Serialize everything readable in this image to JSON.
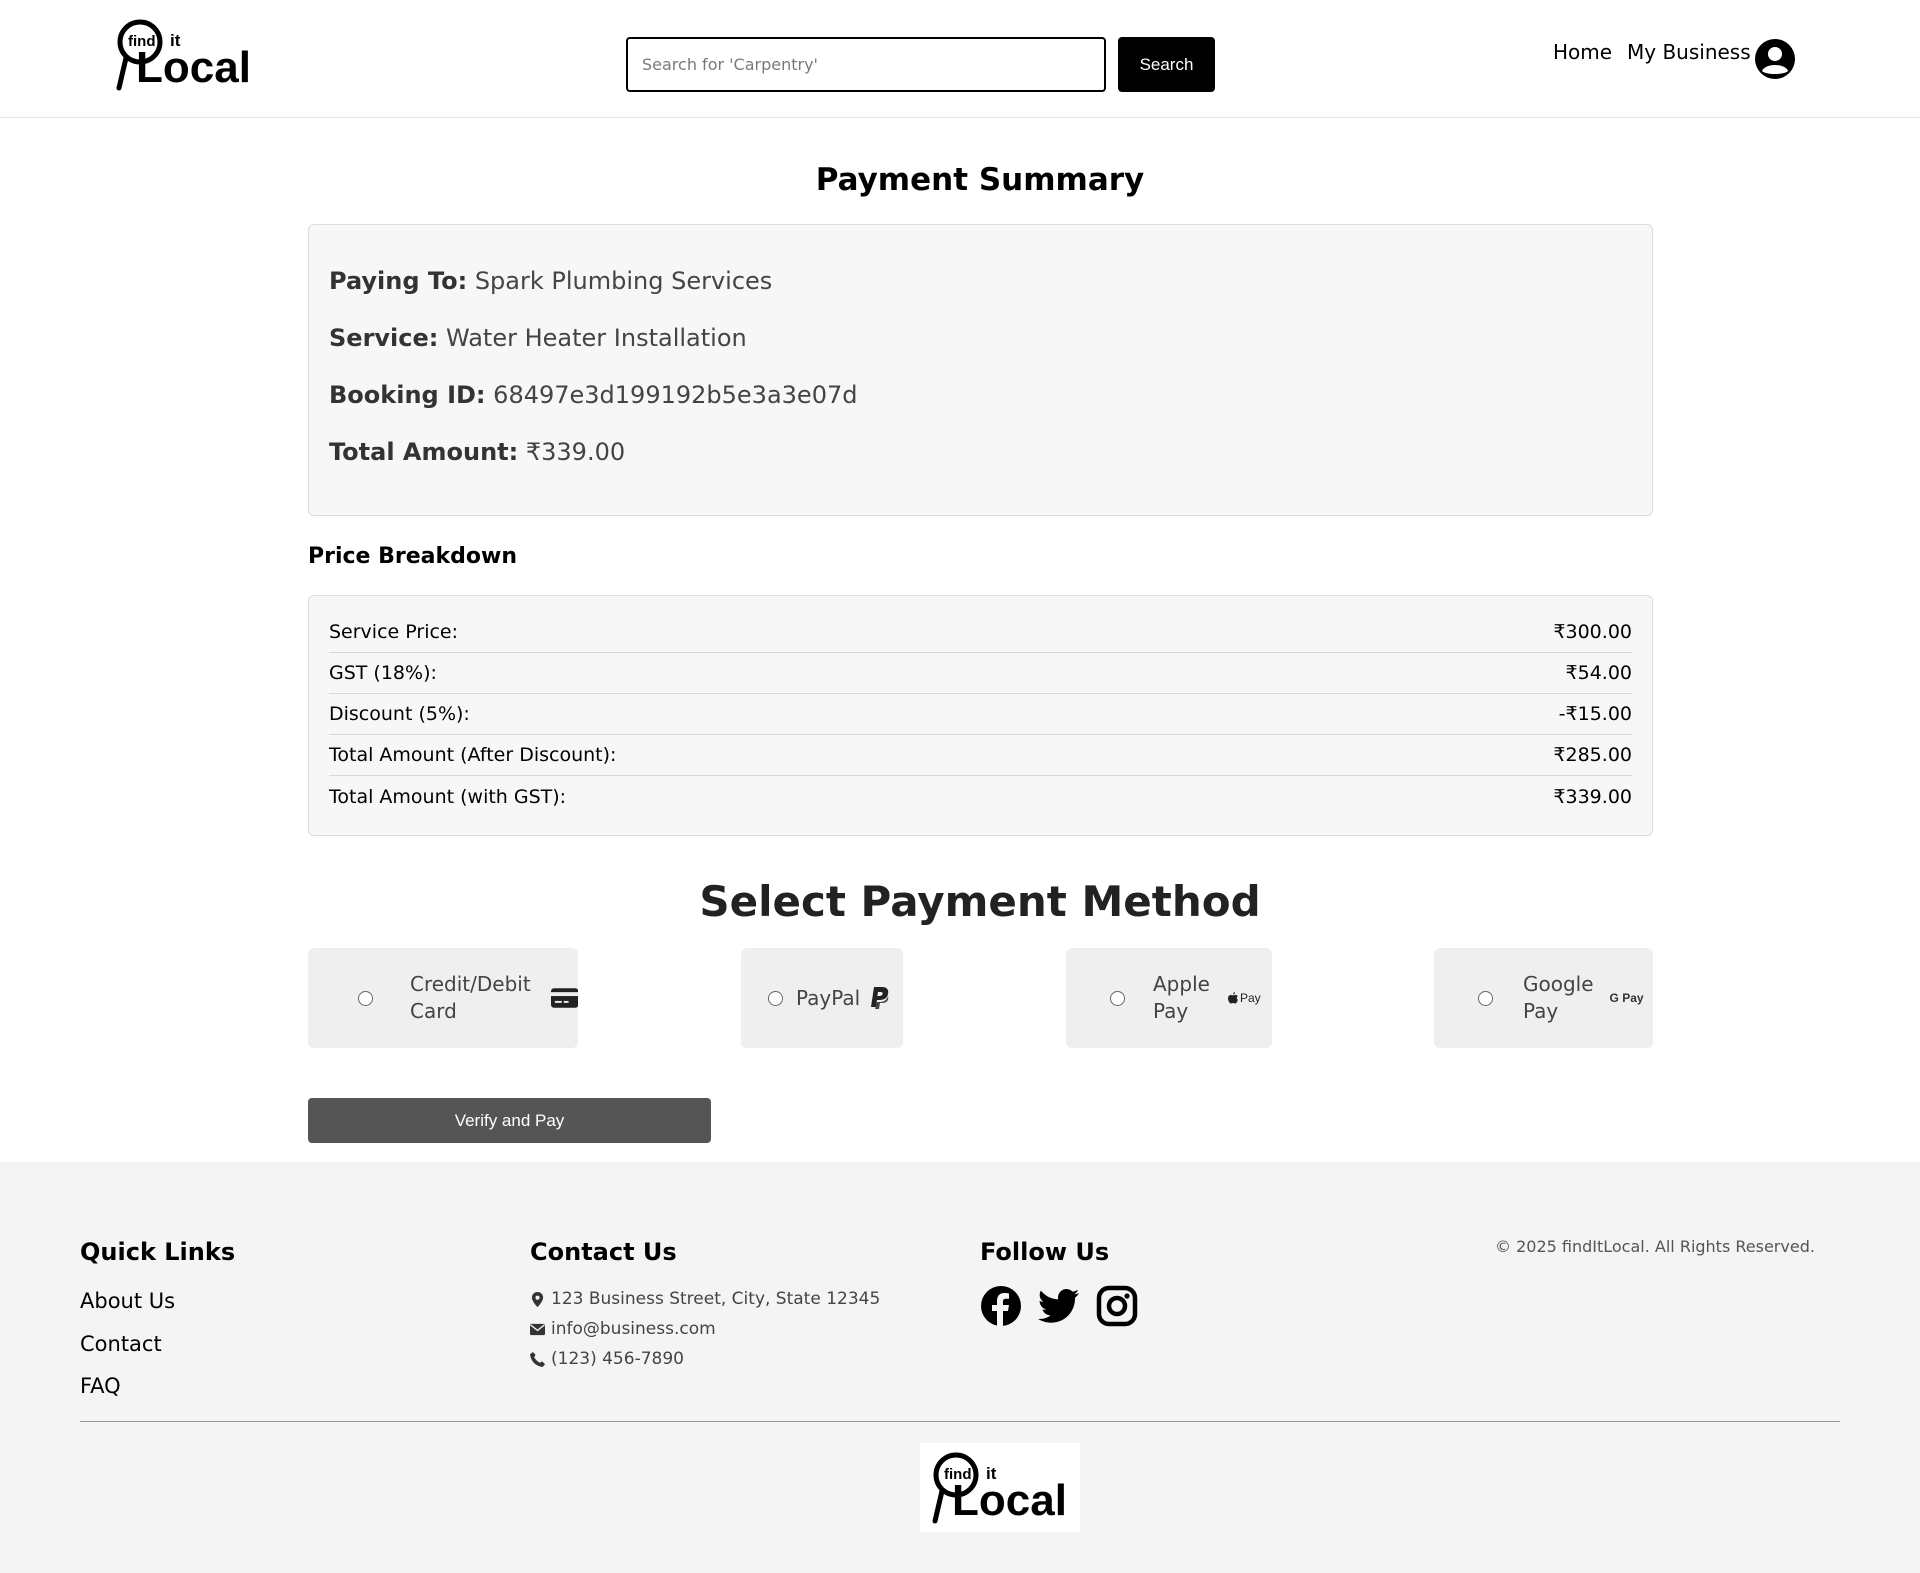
{
  "header": {
    "logo_text_find": "find",
    "logo_text_it": "it",
    "logo_text_local": "Local",
    "search_placeholder": "Search for 'Carpentry'",
    "search_button": "Search",
    "nav_home": "Home",
    "nav_business": "My Business",
    "user_icon": "user-circle-icon"
  },
  "summary": {
    "title": "Payment Summary",
    "paying_to_label": "Paying To:",
    "paying_to_value": "Spark Plumbing Services",
    "service_label": "Service:",
    "service_value": "Water Heater Installation",
    "booking_label": "Booking ID:",
    "booking_value": "68497e3d199192b5e3a3e07d",
    "total_label": "Total Amount:",
    "total_value": "₹339.00"
  },
  "breakdown": {
    "title": "Price Breakdown",
    "rows": [
      {
        "label": "Service Price:",
        "value": "₹300.00"
      },
      {
        "label": "GST (18%):",
        "value": "₹54.00"
      },
      {
        "label": "Discount (5%):",
        "value": "-₹15.00"
      },
      {
        "label": "Total Amount (After Discount):",
        "value": "₹285.00"
      },
      {
        "label": "Total Amount (with GST):",
        "value": "₹339.00"
      }
    ]
  },
  "payment_methods": {
    "title": "Select Payment Method",
    "options": [
      {
        "label_line1": "Credit/Debit",
        "label_line2": "Card",
        "icon": "credit-card-icon"
      },
      {
        "label_line1": "PayPal",
        "label_line2": "",
        "icon": "paypal-icon"
      },
      {
        "label_line1": "Apple",
        "label_line2": "Pay",
        "icon": "apple-pay-icon",
        "icon_text": "Pay"
      },
      {
        "label_line1": "Google",
        "label_line2": "Pay",
        "icon": "google-pay-icon",
        "icon_text": "G Pay"
      }
    ],
    "submit": "Verify and Pay"
  },
  "footer": {
    "quick_links_title": "Quick Links",
    "quick_links": [
      "About Us",
      "Contact",
      "FAQ"
    ],
    "contact_title": "Contact Us",
    "address": "123 Business Street, City, State 12345",
    "email": "info@business.com",
    "phone": "(123) 456-7890",
    "follow_title": "Follow Us",
    "social_icons": [
      "facebook-icon",
      "twitter-icon",
      "instagram-icon"
    ],
    "copyright": "© 2025 findItLocal. All Rights Reserved."
  },
  "colors": {
    "accent": "#000000",
    "pay_button": "#555555",
    "footer_bg": "#f4f4f4",
    "card_bg": "#efefef"
  }
}
